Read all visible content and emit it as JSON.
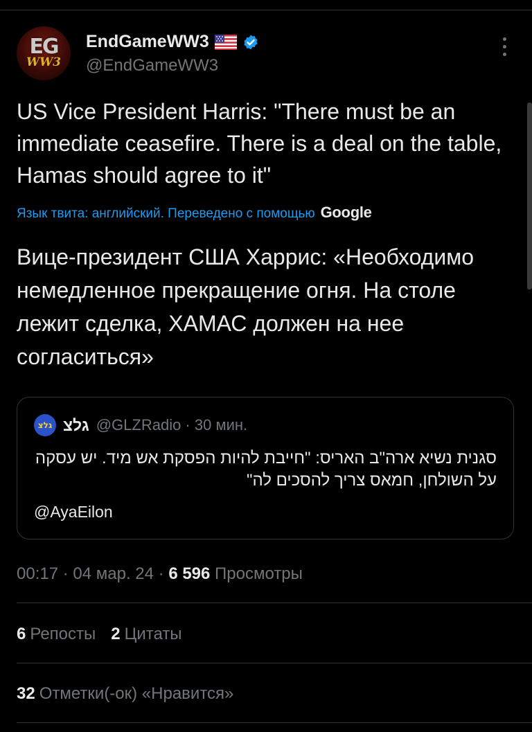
{
  "author": {
    "avatar_text_top": "EG",
    "avatar_text_bottom": "WW3",
    "display_name": "EndGameWW3",
    "flag_icon": "us-flag-icon",
    "verified_icon": "verified-badge-icon",
    "handle": "@EndGameWW3"
  },
  "tweet": {
    "text": "US Vice President Harris: \"There must be an immediate ceasefire. There is a deal on the table, Hamas should agree to it\"",
    "translation_label": "Язык твита: английский. Переведено с помощью",
    "translation_provider": "Google",
    "translated_text": "Вице-президент США Харрис: «Необходимо немедленное прекращение огня. На столе лежит сделка, ХАМАС должен на нее согласиться»"
  },
  "quoted": {
    "avatar_text": "גלצ",
    "name": "גלצ",
    "handle_time": "@GLZRadio · 30 мин.",
    "text": "סגנית נשיא ארה\"ב האריס: \"חייבת להיות הפסקת אש מיד. יש עסקה על השולחן, חמאס צריך להסכים לה\"",
    "mention": "@AyaEilon"
  },
  "meta": {
    "time_date": "00:17 · 04 мар. 24 · ",
    "views_count": "6 596",
    "views_label": "Просмотры"
  },
  "stats": {
    "reposts_count": "6",
    "reposts_label": "Репосты",
    "quotes_count": "2",
    "quotes_label": "Цитаты",
    "likes_count": "32",
    "likes_label": "Отметки(-ок) «Нравится»"
  },
  "colors": {
    "background": "#000000",
    "text": "#e7e9ea",
    "muted": "#71767b",
    "link": "#1d9bf0",
    "border": "#2f3336"
  }
}
